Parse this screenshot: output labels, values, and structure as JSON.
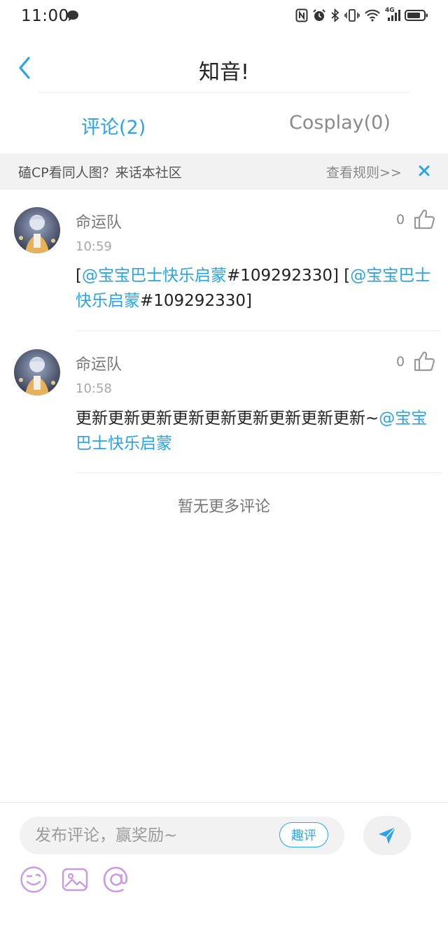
{
  "status_bar": {
    "time": "11:00",
    "network": "4G"
  },
  "header": {
    "title": "知音!",
    "back_icon": "chevron-left-icon"
  },
  "tabs": [
    {
      "label": "评论(2)",
      "active": true
    },
    {
      "label": "Cosplay(0)",
      "active": false
    }
  ],
  "notice": {
    "text": "磕CP看同人图？来话本社区",
    "link": "查看规则>>",
    "close_icon": "close-icon"
  },
  "comments": [
    {
      "username": "命运队",
      "time": "10:59",
      "likes": "0",
      "body": [
        {
          "t": "text",
          "v": "["
        },
        {
          "t": "mention",
          "v": "@宝宝巴士快乐启蒙"
        },
        {
          "t": "text",
          "v": "#109292330] ["
        },
        {
          "t": "mention",
          "v": "@宝宝巴士快乐启蒙"
        },
        {
          "t": "text",
          "v": "#109292330]"
        }
      ]
    },
    {
      "username": "命运队",
      "time": "10:58",
      "likes": "0",
      "body": [
        {
          "t": "text",
          "v": "更新更新更新更新更新更新更新更新更新~"
        },
        {
          "t": "mention",
          "v": "@宝宝巴士快乐启蒙"
        }
      ]
    }
  ],
  "no_more": "暂无更多评论",
  "composer": {
    "placeholder": "发布评论，赢奖励~",
    "quping_label": "趣评",
    "tools": [
      "emoji-icon",
      "image-icon",
      "at-icon"
    ]
  },
  "colors": {
    "accent": "#2aa4e6",
    "tool": "#c89be0"
  }
}
